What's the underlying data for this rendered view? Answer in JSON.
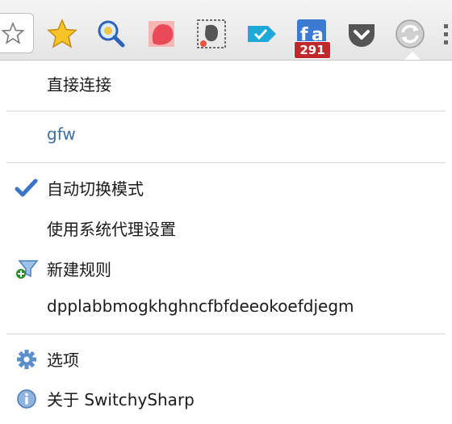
{
  "toolbar": {
    "buttons": [
      {
        "name": "bookmark-star-icon"
      },
      {
        "name": "star-extension-icon"
      },
      {
        "name": "search-extension-icon"
      },
      {
        "name": "red-shape-extension-icon"
      },
      {
        "name": "evernote-clipper-icon"
      },
      {
        "name": "tag-extension-icon"
      },
      {
        "name": "feedly-icon"
      },
      {
        "name": "pocket-icon"
      },
      {
        "name": "switchysharp-icon"
      }
    ],
    "badge": "291"
  },
  "menu": {
    "direct": "直接连接",
    "profile_gfw": "gfw",
    "auto_switch": "自动切换模式",
    "system_proxy": "使用系统代理设置",
    "new_rule": "新建规则",
    "extension_id": "dpplabbmogkhghncfbfdeeokoefdjegm",
    "options": "选项",
    "about": "关于 SwitchySharp"
  },
  "colors": {
    "link": "#3a6fa8",
    "check": "#3a74c4",
    "badge": "#c0282c"
  }
}
